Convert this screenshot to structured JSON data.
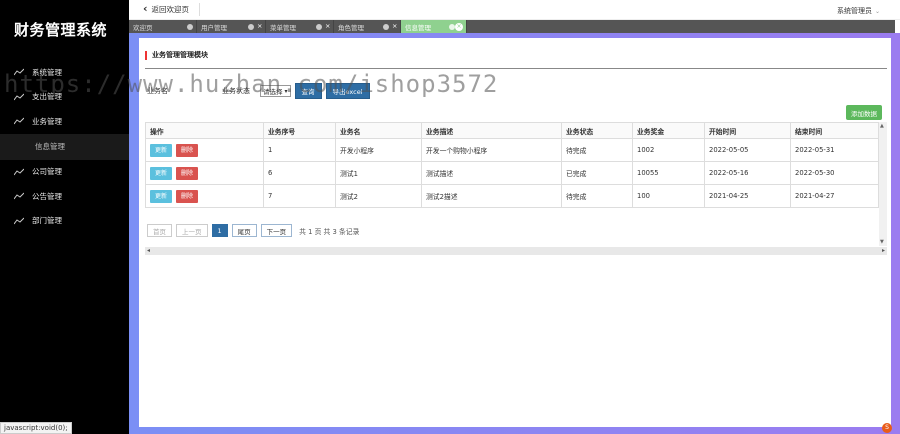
{
  "sidebar": {
    "brand": "财务管理系统",
    "items": [
      {
        "label": "系统管理",
        "sub": false
      },
      {
        "label": "支出管理",
        "sub": false
      },
      {
        "label": "业务管理",
        "sub": false
      },
      {
        "label": "信息管理",
        "sub": true
      },
      {
        "label": "公司管理",
        "sub": false
      },
      {
        "label": "公告管理",
        "sub": false
      },
      {
        "label": "部门管理",
        "sub": false
      }
    ]
  },
  "topbar": {
    "back_label": "返回欢迎页",
    "user_label": "系统管理员"
  },
  "tabs": [
    {
      "label": "欢迎页",
      "active": false
    },
    {
      "label": "用户管理",
      "active": false
    },
    {
      "label": "菜单管理",
      "active": false
    },
    {
      "label": "角色管理",
      "active": false
    },
    {
      "label": "信息管理",
      "active": true
    }
  ],
  "panel": {
    "title": "业务管理管理模块"
  },
  "filters": {
    "field1_label": "业务名",
    "status_select": "业务状态",
    "select2": "请选择",
    "query_button": "查询",
    "export_button": "导出excel",
    "add_button": "添加数据"
  },
  "table": {
    "headers": [
      "操作",
      "业务序号",
      "业务名",
      "业务描述",
      "业务状态",
      "业务奖金",
      "开始时间",
      "结束时间"
    ],
    "edit_label": "更新",
    "delete_label": "删除",
    "rows": [
      [
        "1",
        "开发小程序",
        "开发一个购物小程序",
        "待完成",
        "1002",
        "2022-05-05",
        "2022-05-31"
      ],
      [
        "6",
        "测试1",
        "测试描述",
        "已完成",
        "10055",
        "2022-05-16",
        "2022-05-30"
      ],
      [
        "7",
        "测试2",
        "测试2描述",
        "待完成",
        "100",
        "2021-04-25",
        "2021-04-27"
      ]
    ]
  },
  "pager": {
    "first": "首页",
    "prev": "上一页",
    "current": "1",
    "last": "尾页",
    "next": "下一页",
    "info": "共 1 页 共 3 条记录"
  },
  "watermark": "https://www.huzhan.com/ishop3572",
  "statusbar": "javascript:void(0);",
  "colors": {
    "sidebar_bg": "#000000",
    "active_tab": "#8fd18f",
    "primary": "#2e6da4",
    "success": "#5cb85c",
    "danger": "#d9534f",
    "info": "#5bc0de"
  }
}
